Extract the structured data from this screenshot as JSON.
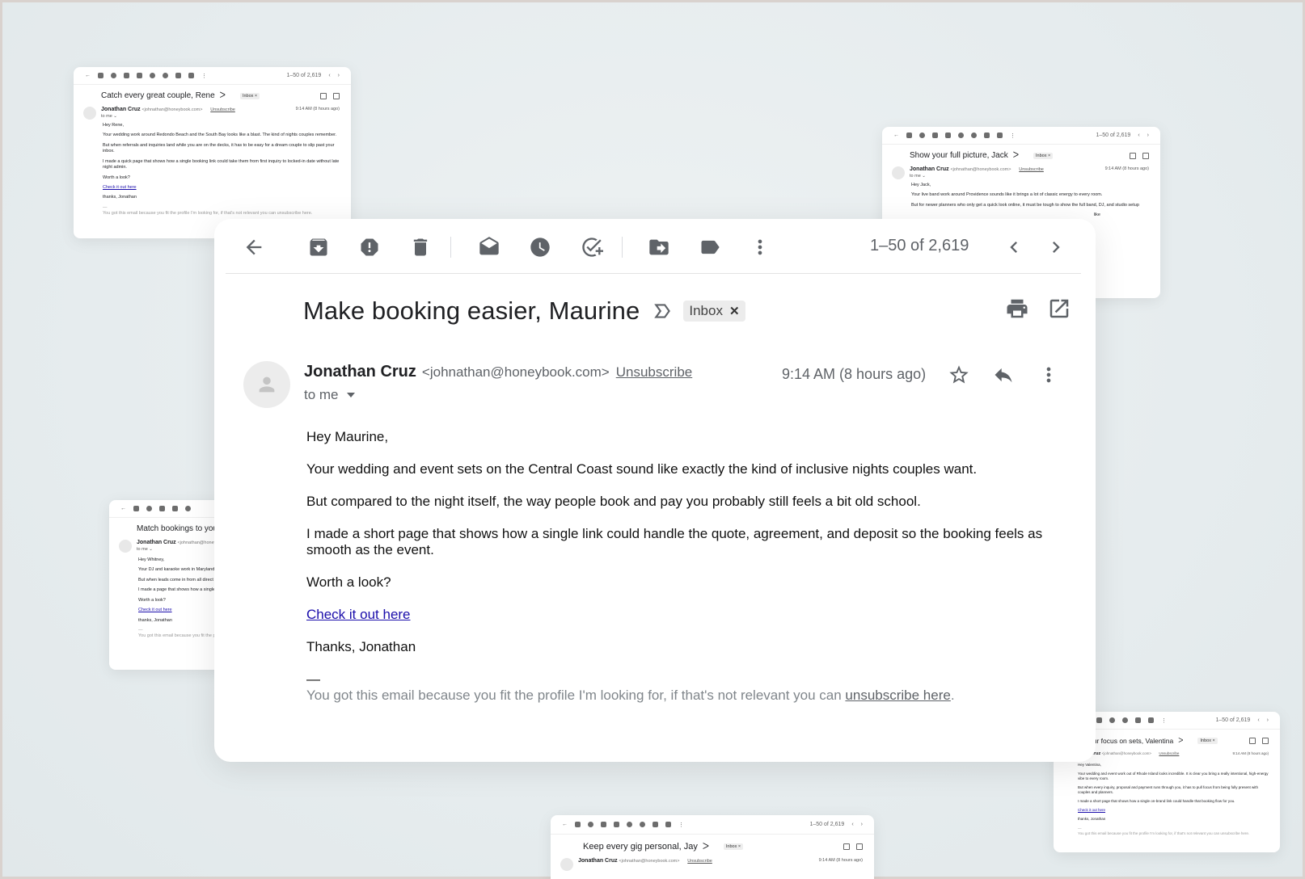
{
  "main": {
    "toolbar": {
      "count": "1–50 of 2,619",
      "icons": [
        "back-icon",
        "archive-icon",
        "report-spam-icon",
        "delete-icon",
        "mark-unread-icon",
        "snooze-icon",
        "add-task-icon",
        "move-to-icon",
        "label-icon",
        "more-icon",
        "prev-icon",
        "next-icon"
      ]
    },
    "subject": "Make booking easier, Maurine",
    "label_chip": "Inbox",
    "label_chip_close": "✕",
    "sender_name": "Jonathan Cruz",
    "sender_addr": "<johnathan@honeybook.com>",
    "unsubscribe": "Unsubscribe",
    "to_me": "to me",
    "time": "9:14 AM (8 hours ago)",
    "body": {
      "greeting": "Hey Maurine,",
      "p1": "Your wedding and event sets on the Central Coast sound like exactly the kind of inclusive nights couples want.",
      "p2": "But compared to the night itself, the way people book and pay you probably still feels a bit old school.",
      "p3": "I made a short page that shows how a single link could handle the quote, agreement, and deposit so the booking feels as smooth as the event.",
      "p4": "Worth a look?",
      "link": "Check it out here",
      "signoff": "Thanks, Jonathan",
      "dash": "—",
      "footer_text": "You got this email because you fit the profile I'm looking for, if that's not relevant you can ",
      "footer_link": "unsubscribe here",
      "footer_end": "."
    }
  },
  "mini_cards": [
    {
      "count": "1–50 of 2,619",
      "subject": "Catch every great couple, Rene",
      "chip": "Inbox ×",
      "sender": "Jonathan Cruz",
      "addr": "<johnathan@honeybook.com>",
      "unsub": "Unsubscribe",
      "time": "9:14 AM  (8 hours ago)",
      "to": "to me ⌄",
      "lines": [
        "Hey Rene,",
        "Your wedding work around Redondo Beach and the South Bay looks like a blast. The kind of nights couples remember.",
        "But when referrals and inquiries land while you are on the decks, it has to be easy for a dream couple to slip past your inbox.",
        "I made a quick page that shows how a single booking link could take them from first inquiry to locked-in date without late night admin.",
        "Worth a look?"
      ],
      "link": "Check it out here",
      "signoff": "thanks, Jonathan",
      "dash": "—",
      "footer": "You got this email because you fit the profile I'm looking for, if that's not relevant you can unsubscribe here."
    },
    {
      "count": "1–50 of 2,619",
      "subject": "Show your full picture, Jack",
      "chip": "Inbox ×",
      "sender": "Jonathan Cruz",
      "addr": "<johnathan@honeybook.com>",
      "unsub": "Unsubscribe",
      "time": "9:14 AM  (8 hours ago)",
      "to": "to me ⌄",
      "lines": [
        "Hey Jack,",
        "Your live band work around Providence sounds like it brings a lot of classic energy to every room.",
        "But for newer planners who only get a quick look online, it must be tough to show the full band, DJ, and studio setup"
      ],
      "trail": "like"
    },
    {
      "subject": "Match bookings to you",
      "sender": "Jonathan Cruz",
      "addr": "<johnathan@honeyb",
      "to": "to me ⌄",
      "lines": [
        "Hey Whitney,",
        "Your DJ and karaoke work in Maryland",
        "But when leads come in from all direct the dance floor.",
        "I made a page that shows how a single run.",
        "Worth a look?"
      ],
      "link": "Check it out here",
      "signoff": "thanks, Jonathan",
      "dash": "—",
      "footer": "You got this email because you fit the p"
    },
    {
      "count": "1–50 of 2,619",
      "subject": "our focus on sets, Valentina",
      "chip": "Inbox ×",
      "sender": "Cruz",
      "addr": "<johnathan@honeybook.com>",
      "unsub": "Unsubscribe",
      "time": "9:14 AM  (8 hours ago)",
      "lines": [
        "Hey Valentina,",
        "Your wedding and event work out of Rhode Island looks incredible. It is clear you bring a really intentional, high-energy vibe to every room.",
        "But when every inquiry, proposal and payment runs through you, it has to pull focus from being fully present with couples and planners.",
        "I made a short page that shows how a single on-brand link could handle that booking flow for you."
      ],
      "link": "Check it out here",
      "signoff": "thanks, Jonathan",
      "dash": "—",
      "footer": "You got this email because you fit the profile I'm looking for, if that's not relevant you can unsubscribe here."
    },
    {
      "count": "1–50 of 2,619",
      "subject": "Keep every gig personal, Jay",
      "chip": "Inbox ×",
      "sender": "Jonathan Cruz",
      "addr": "<johnathan@honeybook.com>",
      "unsub": "Unsubscribe",
      "time": "9:14 AM  (8 hours ago)"
    }
  ]
}
